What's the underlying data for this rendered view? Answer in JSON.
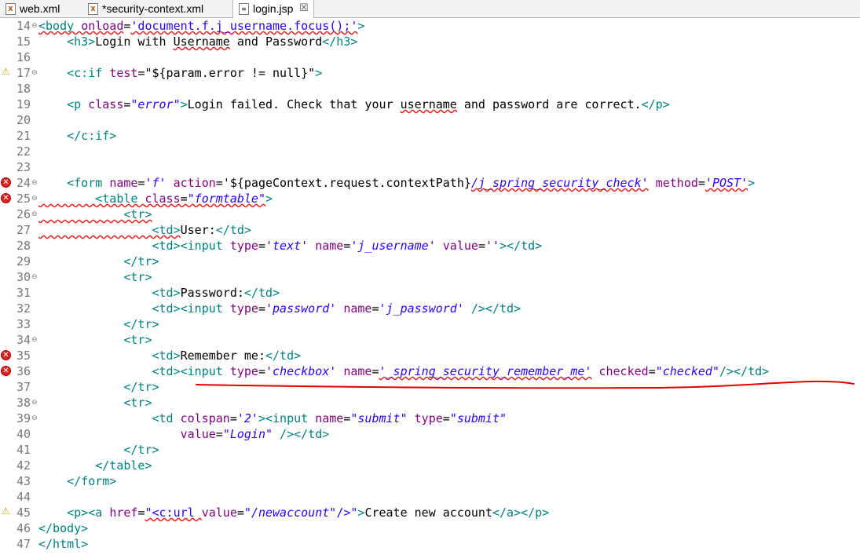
{
  "tabs": [
    {
      "label": "web.xml",
      "icon": "xml-file-icon",
      "active": false
    },
    {
      "label": "*security-context.xml",
      "icon": "xml-file-icon",
      "active": false
    },
    {
      "label": "login.jsp",
      "icon": "jsp-file-icon",
      "active": true,
      "close": "☒"
    }
  ],
  "lines": {
    "l14": {
      "n": "14"
    },
    "l15": {
      "n": "15"
    },
    "l16": {
      "n": "16"
    },
    "l17": {
      "n": "17"
    },
    "l18": {
      "n": "18"
    },
    "l19": {
      "n": "19"
    },
    "l20": {
      "n": "20"
    },
    "l21": {
      "n": "21"
    },
    "l22": {
      "n": "22"
    },
    "l23": {
      "n": "23"
    },
    "l24": {
      "n": "24"
    },
    "l25": {
      "n": "25"
    },
    "l26": {
      "n": "26"
    },
    "l27": {
      "n": "27"
    },
    "l28": {
      "n": "28"
    },
    "l29": {
      "n": "29"
    },
    "l30": {
      "n": "30"
    },
    "l31": {
      "n": "31"
    },
    "l32": {
      "n": "32"
    },
    "l33": {
      "n": "33"
    },
    "l34": {
      "n": "34"
    },
    "l35": {
      "n": "35"
    },
    "l36": {
      "n": "36"
    },
    "l37": {
      "n": "37"
    },
    "l38": {
      "n": "38"
    },
    "l39": {
      "n": "39"
    },
    "l40": {
      "n": "40"
    },
    "l41": {
      "n": "41"
    },
    "l42": {
      "n": "42"
    },
    "l43": {
      "n": "43"
    },
    "l44": {
      "n": "44"
    },
    "l45": {
      "n": "45"
    },
    "l46": {
      "n": "46"
    },
    "l47": {
      "n": "47"
    }
  },
  "code": {
    "l14": [
      "<body ",
      "onload",
      "=",
      "'document.f.j_username.focus();'",
      ">"
    ],
    "l15": [
      "    <h3>",
      "Login with ",
      "Username",
      " and Password",
      "</h3>"
    ],
    "l17": [
      "    <c:if ",
      "test",
      "=\"${param.error != null}\"",
      ">"
    ],
    "l19": [
      "    <p ",
      "class",
      "=",
      "\"error\"",
      ">",
      "Login failed. Check that your ",
      "username",
      " and password are correct.",
      "</p>"
    ],
    "l21": [
      "    </c:if>"
    ],
    "l24": [
      "    <form ",
      "name",
      "=",
      "'f'",
      " ",
      "action",
      "=",
      "'${pageContext.request.contextPath}",
      "/j_spring_security_check'",
      " ",
      "method",
      "=",
      "'POST'",
      ">"
    ],
    "l25": [
      "        <table ",
      "class",
      "=",
      "\"formtable\"",
      ">"
    ],
    "l26": [
      "            <tr>"
    ],
    "l27": [
      "                <td>",
      "User:",
      "</td>"
    ],
    "l28": [
      "                <td><input ",
      "type",
      "=",
      "'text'",
      " ",
      "name",
      "=",
      "'j_username'",
      " ",
      "value",
      "=",
      "''",
      "></td>"
    ],
    "l29": [
      "            </tr>"
    ],
    "l30": [
      "            <tr>"
    ],
    "l31": [
      "                <td>",
      "Password:",
      "</td>"
    ],
    "l32": [
      "                <td><input ",
      "type",
      "=",
      "'password'",
      " ",
      "name",
      "=",
      "'j_password'",
      " /></td>"
    ],
    "l33": [
      "            </tr>"
    ],
    "l34": [
      "            <tr>"
    ],
    "l35": [
      "                <td>",
      "Remember me:",
      "</td>"
    ],
    "l36": [
      "                <td><input ",
      "type",
      "=",
      "'checkbox'",
      " ",
      "name",
      "=",
      "'_spring_security_remember_me'",
      " ",
      "checked",
      "=",
      "\"checked\"",
      "/></td>"
    ],
    "l37": [
      "            </tr>"
    ],
    "l38": [
      "            <tr>"
    ],
    "l39": [
      "                <td ",
      "colspan",
      "=",
      "'2'",
      "><input ",
      "name",
      "=",
      "\"submit\"",
      " ",
      "type",
      "=",
      "\"submit\""
    ],
    "l40": [
      "                    ",
      "value",
      "=",
      "\"Login\"",
      " /></td>"
    ],
    "l41": [
      "            </tr>"
    ],
    "l42": [
      "        </table>"
    ],
    "l43": [
      "    </form>"
    ],
    "l45": [
      "    <p><a ",
      "href",
      "=",
      "\"<c:url ",
      "value",
      "=",
      "\"/newaccount\"",
      "/>\"",
      ">",
      "Create new account",
      "</a></p>"
    ],
    "l46": [
      "</body>"
    ],
    "l47": [
      "</html>"
    ]
  },
  "colors": {
    "tag": "#008080",
    "attr": "#7f007f",
    "value": "#2a00ff",
    "error": "#d22222",
    "warning": "#d9a200",
    "annotation": "#e00000"
  }
}
